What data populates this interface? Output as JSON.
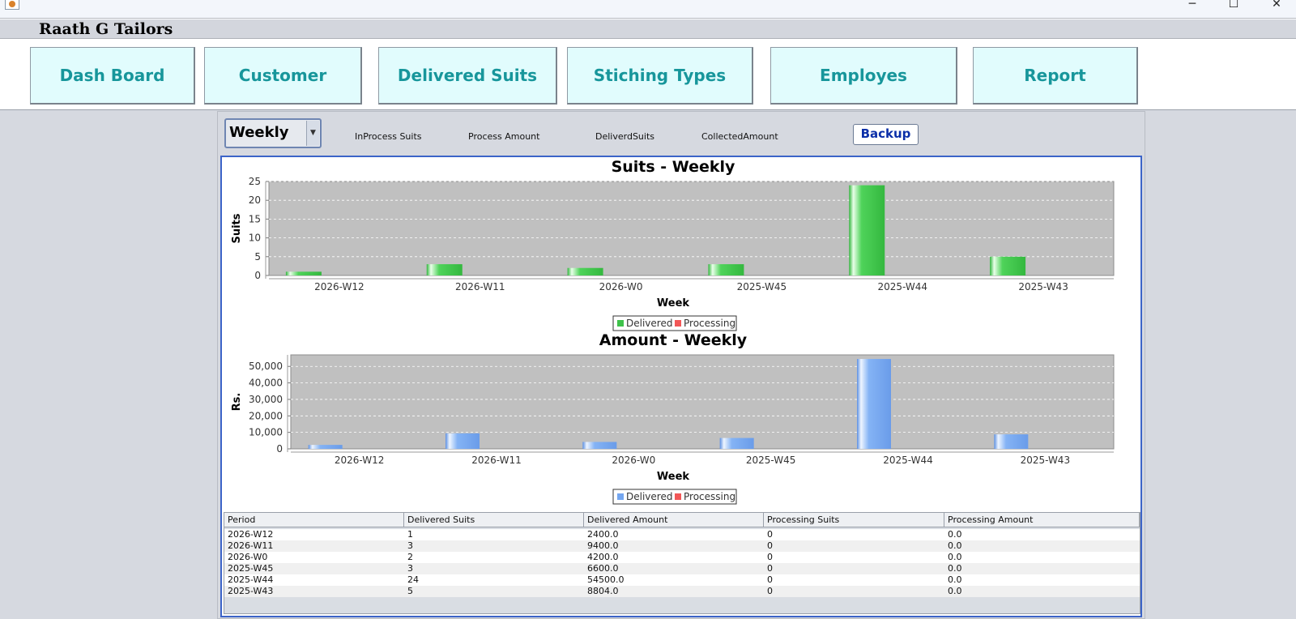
{
  "window": {
    "title_icon": "java-app-icon",
    "controls": [
      "─",
      "☐",
      "✕"
    ]
  },
  "header": {
    "app_title": "Raath G Tailors"
  },
  "nav": {
    "buttons": [
      "Dash Board",
      "Customer",
      "Delivered Suits",
      "Stiching Types",
      "Employes",
      "Report"
    ]
  },
  "toolbar": {
    "period_select": "Weekly",
    "stats": [
      "InProcess Suits",
      "Process Amount",
      "DeliverdSuits",
      "CollectedAmount"
    ],
    "backup_label": "Backup"
  },
  "colors": {
    "accent_teal": "#17969b",
    "delivered_green": "#3ec24a",
    "delivered_blue": "#74a6f0",
    "processing_red": "#f25757",
    "plot_bg": "#c0c0c0"
  },
  "chart_data": [
    {
      "type": "bar",
      "title": "Suits - Weekly",
      "xlabel": "Week",
      "ylabel": "Suits",
      "categories": [
        "2026-W12",
        "2026-W11",
        "2026-W0",
        "2025-W45",
        "2025-W44",
        "2025-W43"
      ],
      "series": [
        {
          "name": "Delivered",
          "values": [
            1,
            3,
            2,
            3,
            24,
            5
          ]
        },
        {
          "name": "Processing",
          "values": [
            0,
            0,
            0,
            0,
            0,
            0
          ]
        }
      ],
      "ylim": [
        0,
        25
      ],
      "yticks": [
        "0",
        "5",
        "10",
        "15",
        "20",
        "25"
      ],
      "grid": true,
      "legend": "bottom-center"
    },
    {
      "type": "bar",
      "title": "Amount - Weekly",
      "xlabel": "Week",
      "ylabel": "Rs.",
      "categories": [
        "2026-W12",
        "2026-W11",
        "2026-W0",
        "2025-W45",
        "2025-W44",
        "2025-W43"
      ],
      "series": [
        {
          "name": "Delivered",
          "values": [
            2400,
            9400,
            4200,
            6600,
            54500,
            8804
          ]
        },
        {
          "name": "Processing",
          "values": [
            0,
            0,
            0,
            0,
            0,
            0
          ]
        }
      ],
      "ylim": [
        0,
        57000
      ],
      "yticks": [
        "0",
        "10,000",
        "20,000",
        "30,000",
        "40,000",
        "50,000"
      ],
      "grid": true,
      "legend": "bottom-center"
    }
  ],
  "table": {
    "columns": [
      "Period",
      "Delivered Suits",
      "Delivered Amount",
      "Processing Suits",
      "Processing Amount"
    ],
    "rows": [
      [
        "2026-W12",
        "1",
        "2400.0",
        "0",
        "0.0"
      ],
      [
        "2026-W11",
        "3",
        "9400.0",
        "0",
        "0.0"
      ],
      [
        "2026-W0",
        "2",
        "4200.0",
        "0",
        "0.0"
      ],
      [
        "2025-W45",
        "3",
        "6600.0",
        "0",
        "0.0"
      ],
      [
        "2025-W44",
        "24",
        "54500.0",
        "0",
        "0.0"
      ],
      [
        "2025-W43",
        "5",
        "8804.0",
        "0",
        "0.0"
      ]
    ]
  }
}
